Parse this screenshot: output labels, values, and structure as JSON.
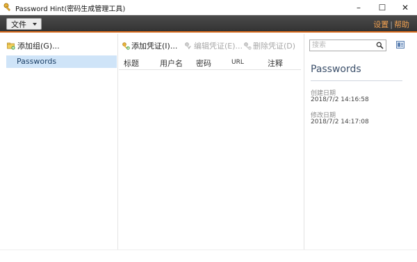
{
  "window": {
    "title": "Password Hint(密码生成管理工具)",
    "minimize_glyph": "–",
    "maximize_glyph": "☐",
    "close_glyph": "✕"
  },
  "menubar": {
    "file_label": "文件",
    "settings_label": "设置",
    "separator": "|",
    "help_label": "帮助",
    "accent_color": "#d86a1c"
  },
  "sidebar": {
    "add_group_label": "添加组(G)...",
    "groups": [
      {
        "label": "Passwords",
        "selected": true
      }
    ]
  },
  "toolbar": {
    "add_label": "添加凭证(I)...",
    "edit_label": "编辑凭证(E)...",
    "delete_label": "删除凭证(D)",
    "add_icon": "key-add-icon",
    "edit_icon": "key-edit-icon",
    "delete_icon": "key-delete-icon"
  },
  "table": {
    "columns": [
      "标题",
      "用户名",
      "密码",
      "URL",
      "注释"
    ],
    "rows": []
  },
  "search": {
    "placeholder": "搜索",
    "value": ""
  },
  "details": {
    "title": "Passwords",
    "created_label": "创建日期",
    "created_value": "2018/7/2 14:16:58",
    "modified_label": "修改日期",
    "modified_value": "2018/7/2 14:17:08"
  }
}
